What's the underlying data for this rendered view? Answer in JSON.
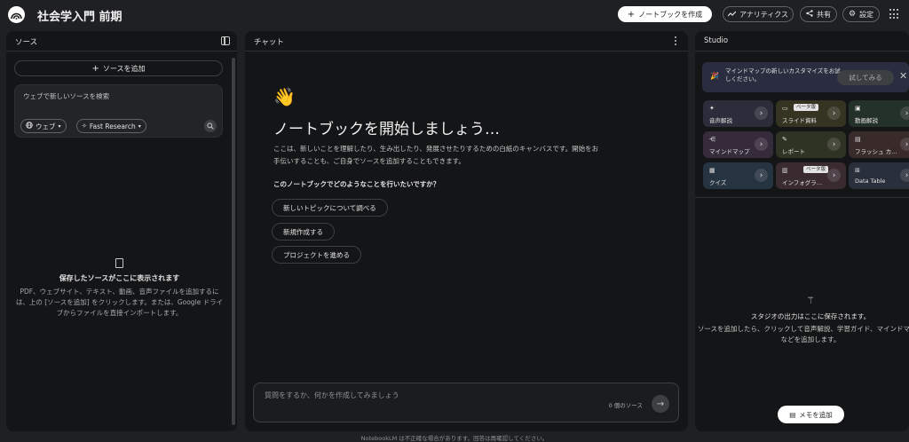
{
  "header": {
    "title": "社会学入門 前期",
    "create_label": "ノートブックを作成",
    "analytics_label": "アナリティクス",
    "share_label": "共有",
    "settings_label": "設定"
  },
  "sources": {
    "title": "ソース",
    "add_label": "ソースを追加",
    "search_placeholder": "ウェブで新しいソースを検索",
    "web_chip": "ウェブ",
    "fast_chip": "Fast Research",
    "empty_title": "保存したソースがここに表示されます",
    "empty_desc": "PDF、ウェブサイト、テキスト、動画、音声ファイルを追加するには、上の [ソースを追加] をクリックします。または、Google ドライブからファイルを直接インポートします。"
  },
  "chat": {
    "title": "チャット",
    "heading": "ノートブックを開始しましょう…",
    "intro": "ここは、新しいことを理解したり、生み出したり、発展させたりするための白紙のキャンバスです。開始をお手伝いすることも、ご自身でソースを追加することもできます。",
    "question": "このノートブックでどのようなことを行いたいですか？",
    "suggestions": [
      "新しいトピックについて調べる",
      "新規作成する",
      "プロジェクトを進める"
    ],
    "input_placeholder": "質問をするか、何かを作成してみましょう",
    "source_count": "0 個のソース"
  },
  "studio": {
    "title": "Studio",
    "banner_text": "マインドマップの新しいカスタマイズをお試しください。",
    "banner_try": "試してみる",
    "tiles": [
      {
        "label": "音声解説",
        "beta": ""
      },
      {
        "label": "スライド資料",
        "beta": "ベータ版"
      },
      {
        "label": "動画解説",
        "beta": ""
      },
      {
        "label": "マインドマップ",
        "beta": ""
      },
      {
        "label": "レポート",
        "beta": ""
      },
      {
        "label": "フラッシュ カ…",
        "beta": ""
      },
      {
        "label": "クイズ",
        "beta": ""
      },
      {
        "label": "インフォグラ…",
        "beta": "ベータ版"
      },
      {
        "label": "Data Table",
        "beta": ""
      }
    ],
    "empty_title": "スタジオの出力はここに保存されます。",
    "empty_desc": "ソースを追加したら、クリックして音声解説、学習ガイド、マインドマップなどを追加します。",
    "add_note_label": "メモを追加"
  },
  "footer": {
    "disclaimer": "NotebookLM は不正確な場合があります。回答は再確認してください。"
  }
}
